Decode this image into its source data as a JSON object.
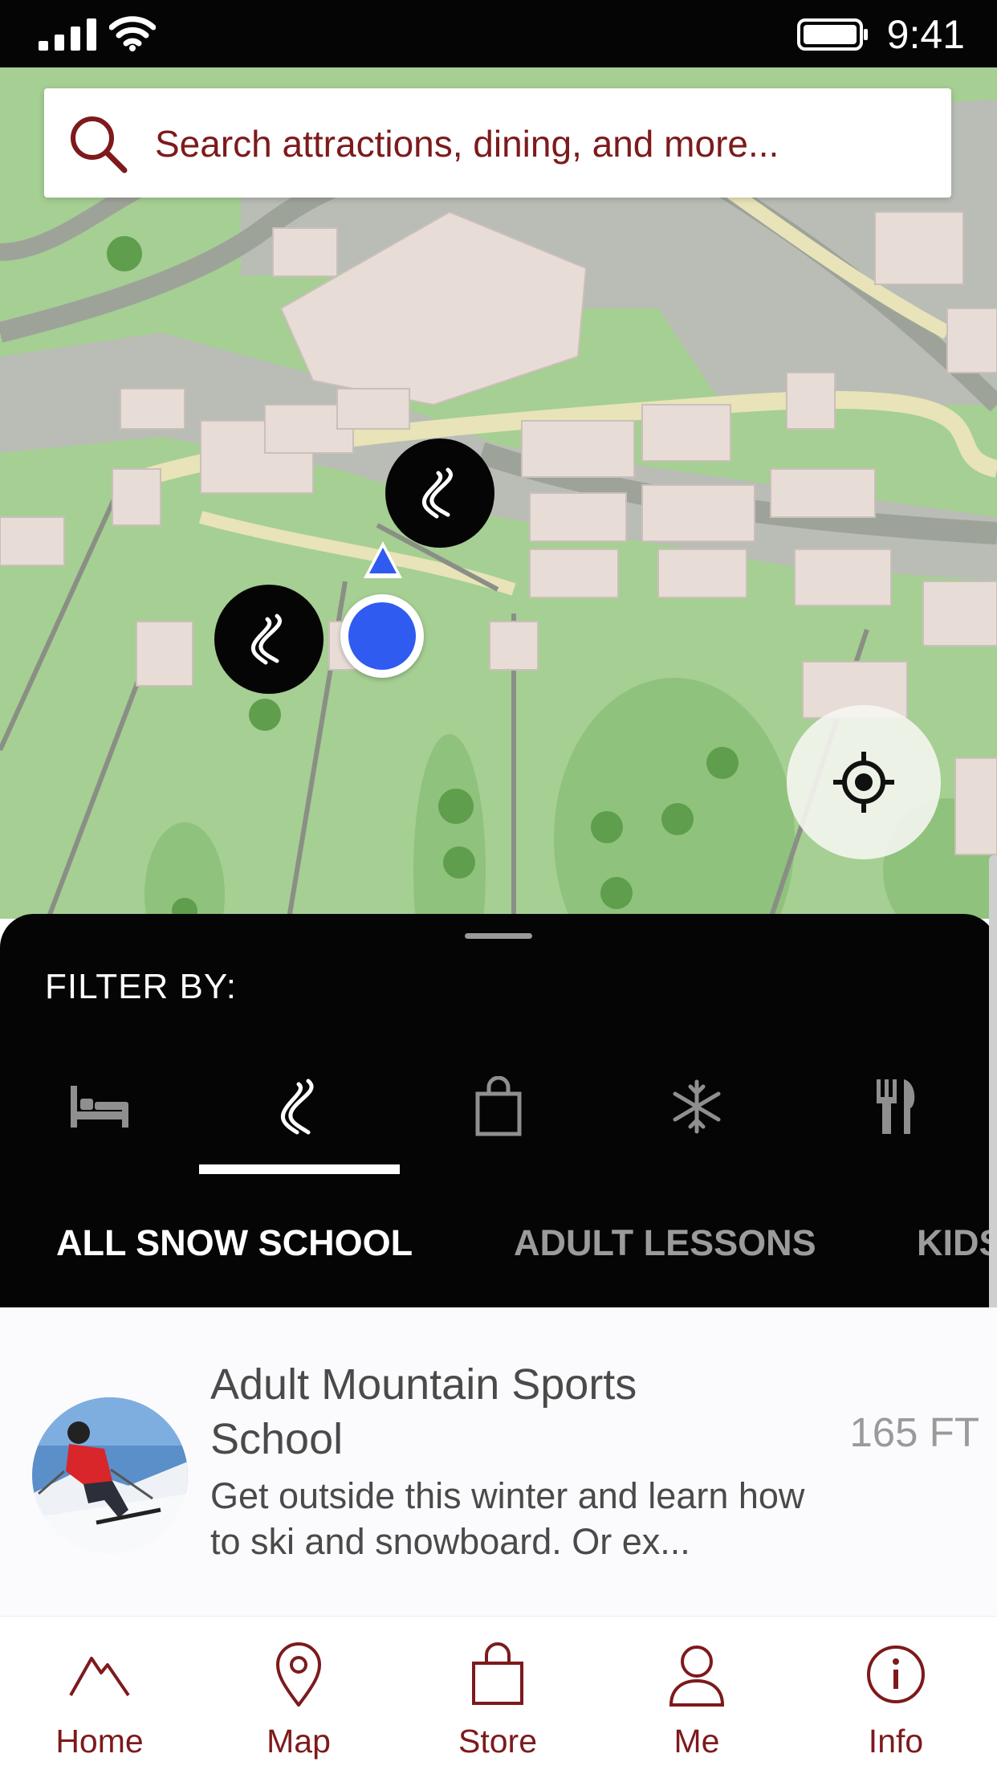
{
  "status_bar": {
    "time": "9:41"
  },
  "search": {
    "placeholder": "Search attractions, dining, and more..."
  },
  "map": {
    "pins": [
      {
        "icon": "ski-trail-icon"
      },
      {
        "icon": "ski-trail-icon"
      }
    ],
    "locate_icon": "crosshair-icon"
  },
  "filter": {
    "title": "FILTER BY:",
    "categories": [
      {
        "icon": "bed-icon",
        "selected": false
      },
      {
        "icon": "ski-trail-icon",
        "selected": true
      },
      {
        "icon": "shopping-bag-icon",
        "selected": false
      },
      {
        "icon": "snowflake-icon",
        "selected": false
      },
      {
        "icon": "fork-knife-icon",
        "selected": false
      }
    ],
    "subtabs": [
      {
        "label": "ALL SNOW SCHOOL",
        "selected": true
      },
      {
        "label": "ADULT LESSONS",
        "selected": false
      },
      {
        "label": "KIDS",
        "selected": false
      }
    ]
  },
  "list": {
    "items": [
      {
        "title": "Adult Mountain Sports School",
        "description": "Get outside this winter and learn how to ski and snowboard. Or ex...",
        "distance": "165 FT"
      }
    ]
  },
  "tabbar": {
    "tabs": [
      {
        "label": "Home",
        "icon": "mountain-icon"
      },
      {
        "label": "Map",
        "icon": "map-pin-icon"
      },
      {
        "label": "Store",
        "icon": "shopping-bag-icon"
      },
      {
        "label": "Me",
        "icon": "person-icon"
      },
      {
        "label": "Info",
        "icon": "info-icon"
      }
    ]
  },
  "colors": {
    "accent": "#7d1a1c",
    "user_location": "#2f5bf0",
    "sheet": "#050505"
  }
}
